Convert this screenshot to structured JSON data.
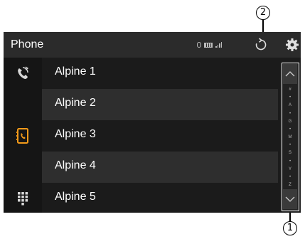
{
  "callouts": {
    "top": "2",
    "bottom": "1"
  },
  "header": {
    "title": "Phone"
  },
  "icons": {
    "bluetooth": "bluetooth-icon",
    "battery": "battery-icon",
    "signal": "signal-icon",
    "refresh": "refresh-icon",
    "settings": "gear-icon",
    "recent_calls": "recent-calls-icon",
    "contacts": "contacts-icon",
    "keypad": "keypad-icon",
    "scroll_up": "chevron-up-icon",
    "scroll_down": "chevron-down-icon"
  },
  "contacts": [
    {
      "name": "Alpine 1"
    },
    {
      "name": "Alpine 2"
    },
    {
      "name": "Alpine 3"
    },
    {
      "name": "Alpine 4"
    },
    {
      "name": "Alpine 5"
    }
  ],
  "index_letters": [
    "#",
    "•",
    "A",
    "•",
    "G",
    "•",
    "M",
    "•",
    "S",
    "•",
    "Y",
    "•",
    "Z"
  ],
  "colors": {
    "accent": "#f29a1a",
    "background": "#1b1b1b",
    "header": "#2b2b2b"
  }
}
